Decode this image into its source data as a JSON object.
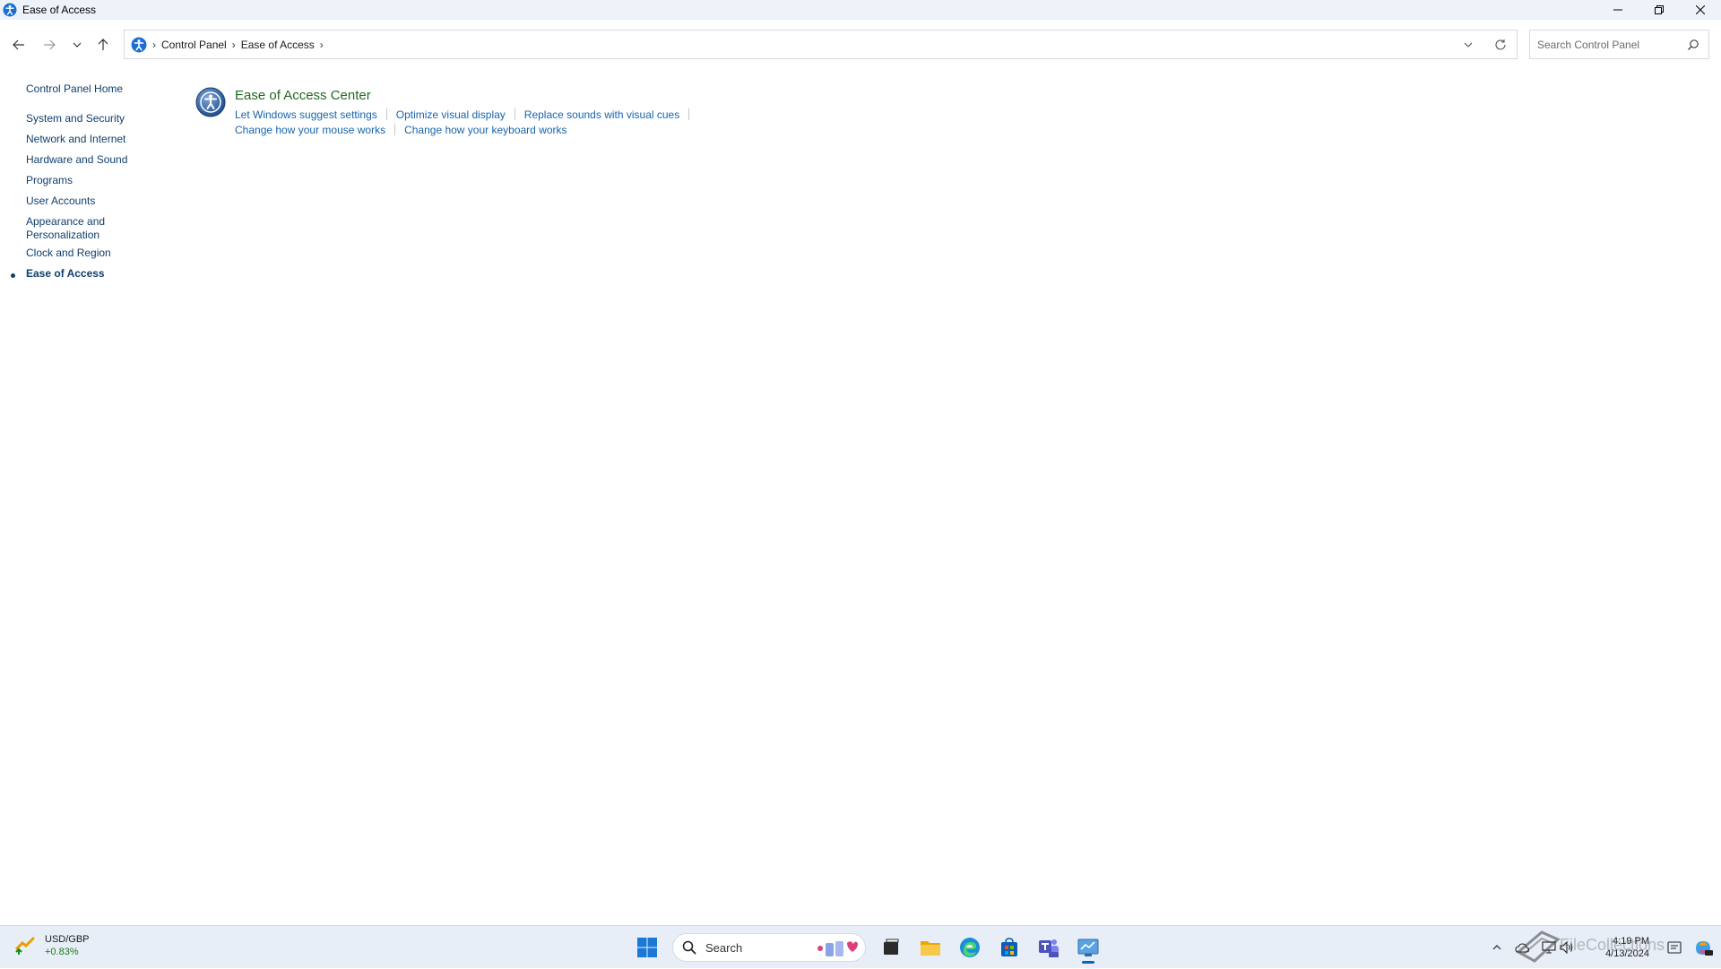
{
  "window": {
    "title": "Ease of Access",
    "controls": {
      "minimize": "minimize",
      "restore": "restore",
      "close": "close"
    }
  },
  "nav": {
    "breadcrumb": [
      "Control Panel",
      "Ease of Access"
    ],
    "search_placeholder": "Search Control Panel"
  },
  "sidebar": {
    "home": "Control Panel Home",
    "items": [
      "System and Security",
      "Network and Internet",
      "Hardware and Sound",
      "Programs",
      "User Accounts",
      "Appearance and",
      "Personalization",
      "Clock and Region",
      "Ease of Access"
    ],
    "active_index": 8
  },
  "main": {
    "category_title": "Ease of Access Center",
    "links_row1": [
      "Let Windows suggest settings",
      "Optimize visual display",
      "Replace sounds with visual cues"
    ],
    "links_row2": [
      "Change how your mouse works",
      "Change how your keyboard works"
    ]
  },
  "taskbar": {
    "widget_title": "USD/GBP",
    "widget_change": "+0.83%",
    "search_label": "Search",
    "clock_time": "4:19 PM",
    "clock_date": "4/13/2024",
    "icons": [
      "start-icon",
      "task-view-icon",
      "file-explorer-icon",
      "edge-icon",
      "store-icon",
      "teams-icon",
      "control-panel-icon"
    ]
  },
  "watermark": "FileCollections",
  "colors": {
    "link": "#1665b0",
    "sidebar_link": "#0f3f6e",
    "category_title": "#1e6b1e",
    "taskbar_bg": "#e8eef7",
    "titlebar_bg": "#eef3f9"
  }
}
